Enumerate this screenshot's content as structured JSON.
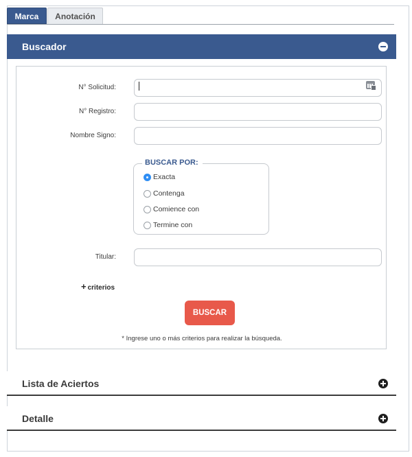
{
  "tabs": [
    {
      "label": "Marca",
      "active": true
    },
    {
      "label": "Anotación",
      "active": false
    }
  ],
  "buscador": {
    "title": "Buscador",
    "fields": {
      "solicitud": {
        "label": "N° Solicitud:",
        "value": ""
      },
      "registro": {
        "label": "N° Registro:",
        "value": ""
      },
      "nombre_signo": {
        "label": "Nombre Signo:",
        "value": ""
      },
      "titular": {
        "label": "Titular:",
        "value": ""
      }
    },
    "buscar_por": {
      "legend": "BUSCAR POR:",
      "options": [
        "Exacta",
        "Contenga",
        "Comience con",
        "Termine con"
      ],
      "selected": "Exacta"
    },
    "more_criteria_label": "criterios",
    "search_button_label": "BUSCAR",
    "hint": "* Ingrese uno o más criterios para realizar la búsqueda."
  },
  "sections": {
    "lista_title": "Lista de Aciertos",
    "detalle_title": "Detalle"
  },
  "colors": {
    "accent": "#3a5a8f",
    "button": "#e8594a",
    "radio_selected": "#2f8ef4"
  }
}
